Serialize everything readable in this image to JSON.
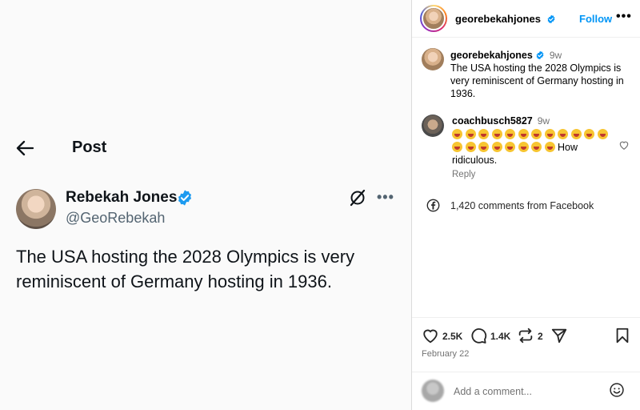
{
  "tweet": {
    "header_title": "Post",
    "display_name": "Rebekah Jones",
    "handle": "@GeoRebekah",
    "text": "The USA hosting the 2028 Olympics is very reminiscent of Germany hosting in 1936.",
    "icons": [
      "back-arrow-icon",
      "verified-badge-icon",
      "grok-icon",
      "more-options-icon"
    ]
  },
  "ig": {
    "header": {
      "username": "georebekahjones",
      "follow_label": "Follow",
      "more_label": "•••"
    },
    "caption": {
      "username": "georebekahjones",
      "time": "9w",
      "text": "The USA hosting the 2028 Olympics is very reminiscent of Germany hosting in 1936."
    },
    "comment": {
      "username": "coachbusch5827",
      "time": "9w",
      "emoji_count": 20,
      "emoji_name": "laughing-crying-emoji",
      "text": "How ridiculous.",
      "reply_label": "Reply"
    },
    "facebook_comments": "1,420 comments from Facebook",
    "actions": {
      "likes": "2.5K",
      "comments": "1.4K",
      "reposts": "2"
    },
    "date": "February 22",
    "add_comment_placeholder": "Add a comment..."
  },
  "colors": {
    "instagram_link": "#0095f6",
    "verified": "#1d9bf0",
    "muted_text": "#737373",
    "tweet_text": "#0f1419"
  }
}
